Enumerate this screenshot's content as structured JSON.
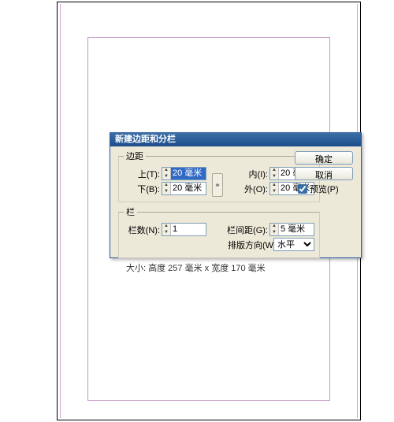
{
  "dialog": {
    "title": "新建边距和分栏",
    "margins": {
      "legend": "边距",
      "top_label": "上(T):",
      "top_value": "20 毫米",
      "bottom_label": "下(B):",
      "bottom_value": "20 毫米",
      "inside_label": "内(I):",
      "inside_value": "20 毫米",
      "outside_label": "外(O):",
      "outside_value": "20 毫米",
      "link_icon": "⚭"
    },
    "columns": {
      "legend": "栏",
      "count_label": "栏数(N):",
      "count_value": "1",
      "gutter_label": "栏间距(G):",
      "gutter_value": "5 毫米",
      "direction_label": "排版方向(W):",
      "direction_value": "水平"
    },
    "size_text": "大小: 高度 257 毫米 x 宽度 170 毫米",
    "ok": "确定",
    "cancel": "取消",
    "preview_label": "预览(P)"
  }
}
